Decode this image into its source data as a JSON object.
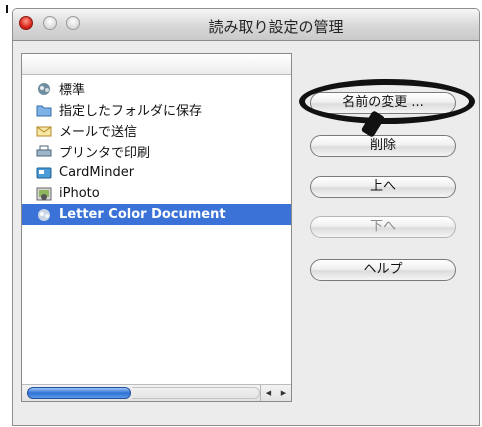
{
  "window": {
    "title": "読み取り設定の管理"
  },
  "list": {
    "items": [
      {
        "label": "標準",
        "icon": "standard-scan-icon"
      },
      {
        "label": "指定したフォルダに保存",
        "icon": "folder-icon"
      },
      {
        "label": "メールで送信",
        "icon": "mail-icon"
      },
      {
        "label": "プリンタで印刷",
        "icon": "printer-icon"
      },
      {
        "label": "CardMinder",
        "icon": "cardminder-icon"
      },
      {
        "label": "iPhoto",
        "icon": "iphoto-icon"
      },
      {
        "label": "Letter Color Document",
        "icon": "document-icon",
        "selected": true
      }
    ]
  },
  "buttons": {
    "rename": "名前の変更 ...",
    "delete": "削除",
    "up": "上へ",
    "down": "下へ",
    "help": "ヘルプ"
  },
  "colors": {
    "selection": "#3a72d8",
    "scroll_thumb": "#2f72d4",
    "annotation": "#111111"
  }
}
